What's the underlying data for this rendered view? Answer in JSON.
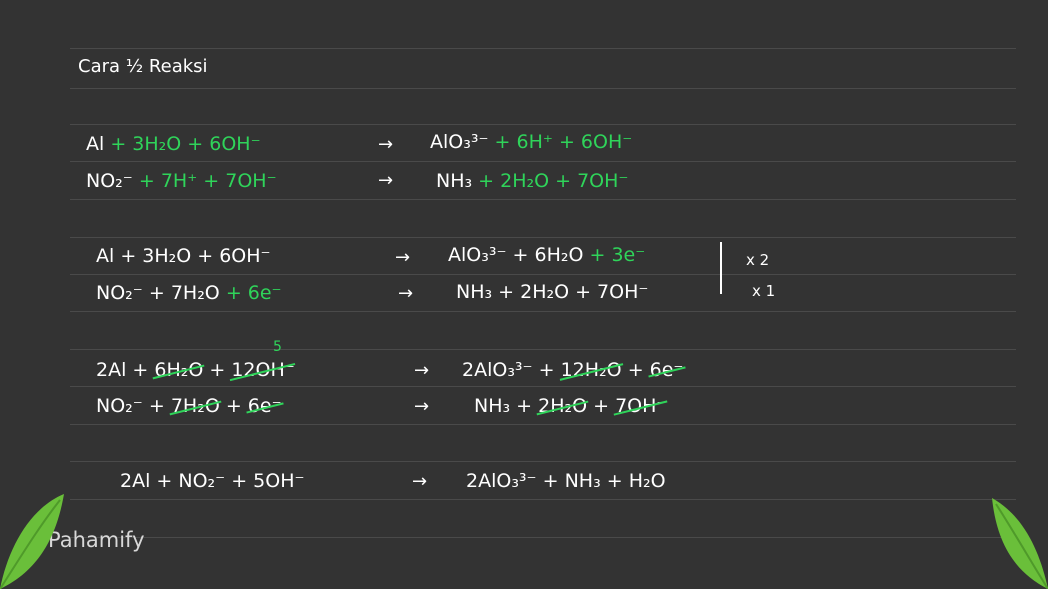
{
  "title": "Cara ½ Reaksi",
  "step1": {
    "r1_left_a": "Al",
    "r1_left_b": "+ 3H₂O + 6OH⁻",
    "r1_right_a": "AlO₃³⁻",
    "r1_right_b": "+ 6H⁺ + 6OH⁻",
    "r2_left_a": "NO₂⁻",
    "r2_left_b": "+ 7H⁺ + 7OH⁻",
    "r2_right_a": "NH₃",
    "r2_right_b": "+ 2H₂O + 7OH⁻"
  },
  "step2": {
    "r1_left": "Al + 3H₂O + 6OH⁻",
    "r1_right_a": "AlO₃³⁻ + 6H₂O",
    "r1_right_b": "+ 3e⁻",
    "r1_mult": "x 2",
    "r2_left_a": "NO₂⁻ + 7H₂O",
    "r2_left_b": "+ 6e⁻",
    "r2_right": "NH₃ + 2H₂O + 7OH⁻",
    "r2_mult": "x 1"
  },
  "step3": {
    "annot": "5",
    "r1_left_a": "2Al +",
    "r1_left_s1": "6H₂O",
    "r1_left_m": "+",
    "r1_left_s2": "12OH⁻",
    "r1_right_a": "2AlO₃³⁻ +",
    "r1_right_s1": "12H₂O",
    "r1_right_m": "+",
    "r1_right_s2": "6e⁻",
    "r2_left_a": "NO₂⁻ +",
    "r2_left_s1": "7H₂O",
    "r2_left_m": "+",
    "r2_left_s2": "6e⁻",
    "r2_right_a": "NH₃ +",
    "r2_right_s1": "2H₂O",
    "r2_right_m": "+",
    "r2_right_s2": "7OH⁻"
  },
  "final": {
    "left": "2Al + NO₂⁻ + 5OH⁻",
    "right": "2AlO₃³⁻ + NH₃ + H₂O"
  },
  "logo_text": "Pahamify",
  "colors": {
    "background": "#333333",
    "ink": "#ffffff",
    "green": "#2fd45a",
    "leaf": "#6abf3a"
  }
}
